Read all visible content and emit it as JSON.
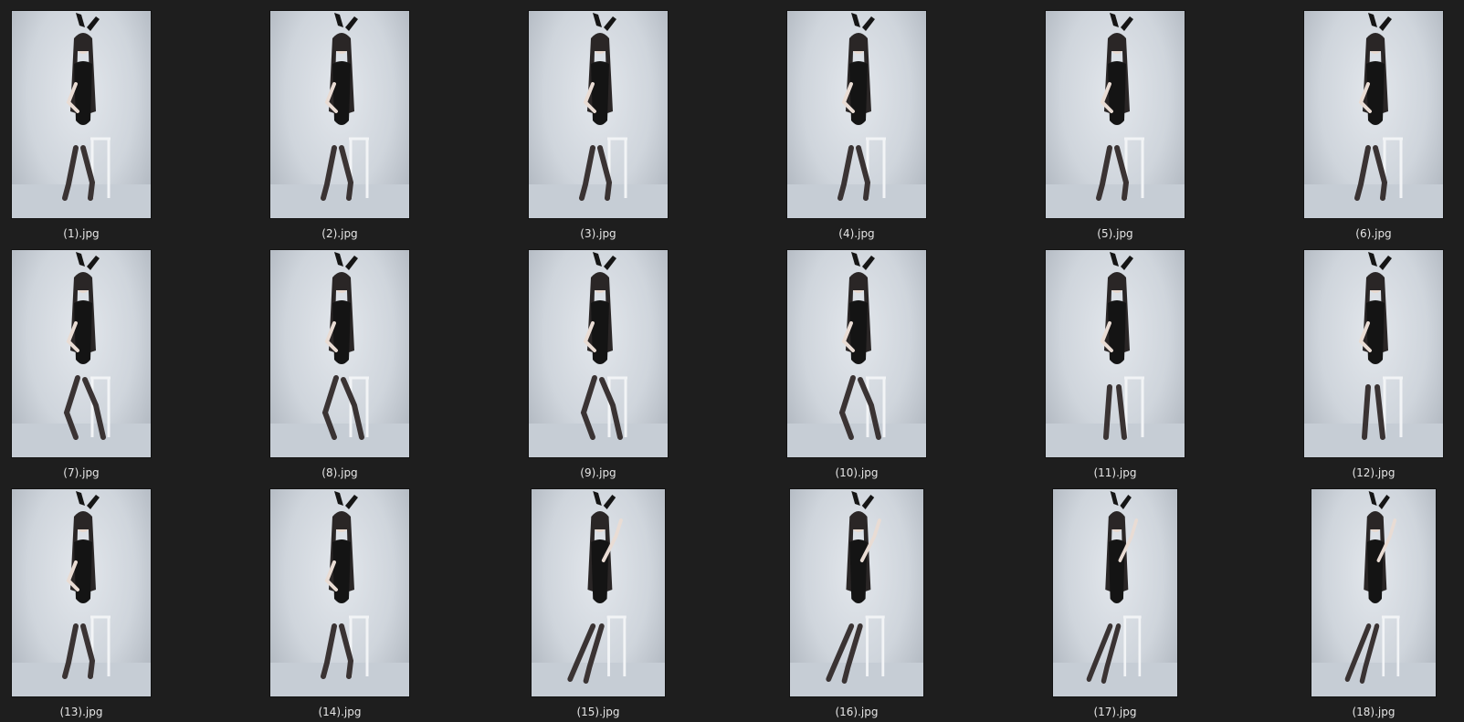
{
  "window": {
    "background": "#1e1e1e"
  },
  "gallery": {
    "items": [
      {
        "name": "(1).jpg",
        "thumbnail": "photo-thumbnail",
        "pose": "seated"
      },
      {
        "name": "(2).jpg",
        "thumbnail": "photo-thumbnail",
        "pose": "seated"
      },
      {
        "name": "(3).jpg",
        "thumbnail": "photo-thumbnail",
        "pose": "seated"
      },
      {
        "name": "(4).jpg",
        "thumbnail": "photo-thumbnail",
        "pose": "seated"
      },
      {
        "name": "(5).jpg",
        "thumbnail": "photo-thumbnail",
        "pose": "seated"
      },
      {
        "name": "(6).jpg",
        "thumbnail": "photo-thumbnail",
        "pose": "seated"
      },
      {
        "name": "(7).jpg",
        "thumbnail": "photo-thumbnail",
        "pose": "leaning"
      },
      {
        "name": "(8).jpg",
        "thumbnail": "photo-thumbnail",
        "pose": "leaning"
      },
      {
        "name": "(9).jpg",
        "thumbnail": "photo-thumbnail",
        "pose": "leaning"
      },
      {
        "name": "(10).jpg",
        "thumbnail": "photo-thumbnail",
        "pose": "leaning"
      },
      {
        "name": "(11).jpg",
        "thumbnail": "photo-thumbnail",
        "pose": "standing"
      },
      {
        "name": "(12).jpg",
        "thumbnail": "photo-thumbnail",
        "pose": "standing"
      },
      {
        "name": "(13).jpg",
        "thumbnail": "photo-thumbnail",
        "pose": "seated"
      },
      {
        "name": "(14).jpg",
        "thumbnail": "photo-thumbnail",
        "pose": "seated"
      },
      {
        "name": "(15).jpg",
        "thumbnail": "photo-thumbnail",
        "pose": "arm-raised"
      },
      {
        "name": "(16).jpg",
        "thumbnail": "photo-thumbnail",
        "pose": "arm-raised"
      },
      {
        "name": "(17).jpg",
        "thumbnail": "photo-thumbnail",
        "pose": "arm-raised"
      },
      {
        "name": "(18).jpg",
        "thumbnail": "photo-thumbnail",
        "pose": "arm-raised"
      }
    ]
  }
}
